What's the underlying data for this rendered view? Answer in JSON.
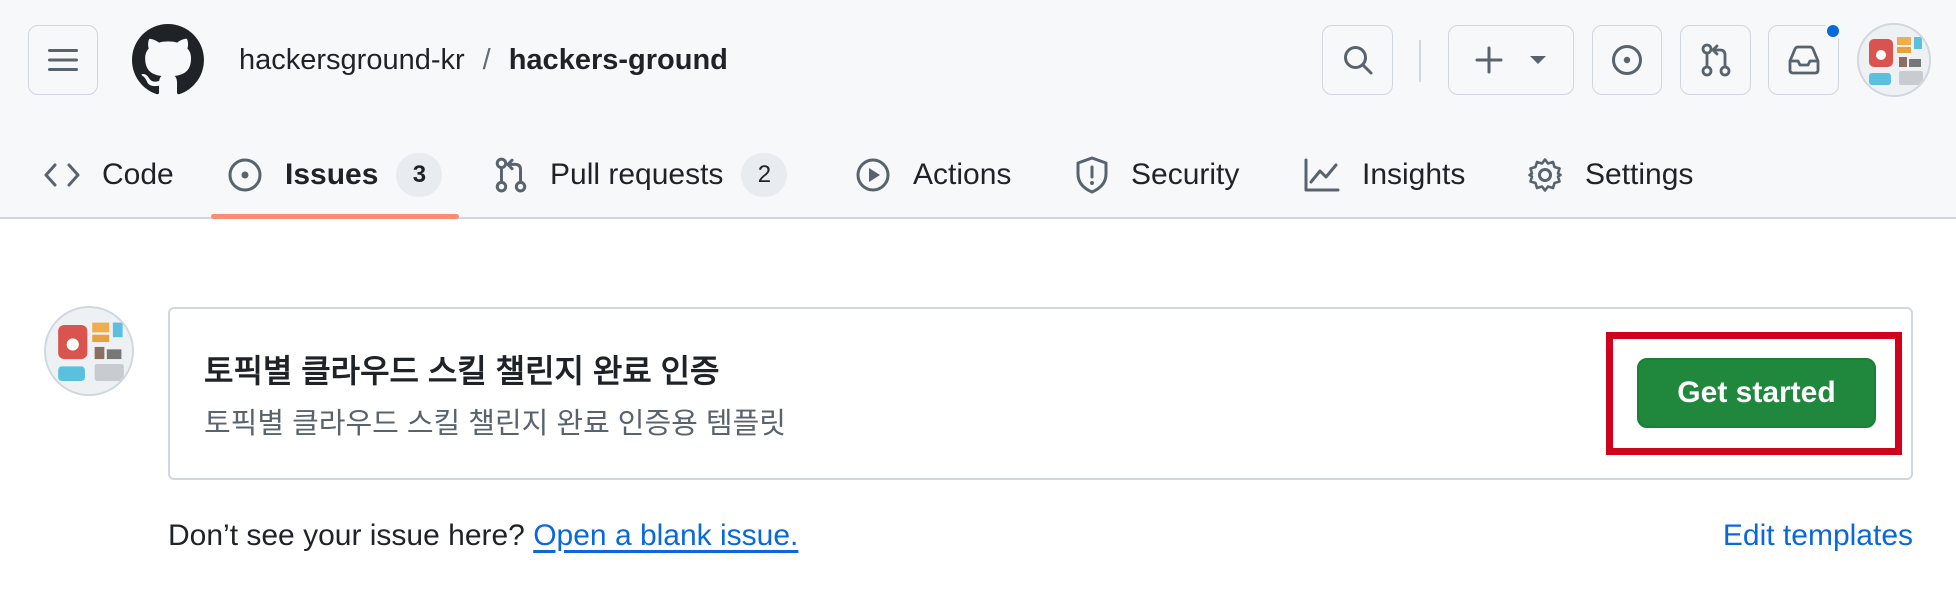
{
  "header": {
    "repo_owner": "hackersground-kr",
    "separator": "/",
    "repo_name": "hackers-ground",
    "icons": {
      "menu": "hamburger-menu-icon",
      "logo": "github-logo-icon",
      "search": "search-icon",
      "create": "plus-icon",
      "create_dropdown": "triangle-down-icon",
      "issues": "issue-opened-icon",
      "pull_requests": "git-pull-request-icon",
      "inbox": "inbox-icon"
    },
    "notification_color": "#0969da"
  },
  "tabs": [
    {
      "label": "Code",
      "icon": "code-icon"
    },
    {
      "label": "Issues",
      "icon": "issue-opened-icon",
      "count": "3",
      "selected": true
    },
    {
      "label": "Pull requests",
      "icon": "git-pull-request-icon",
      "count": "2"
    },
    {
      "label": "Actions",
      "icon": "play-icon"
    },
    {
      "label": "Security",
      "icon": "shield-icon"
    },
    {
      "label": "Insights",
      "icon": "graph-icon"
    },
    {
      "label": "Settings",
      "icon": "gear-icon"
    }
  ],
  "template": {
    "title": "토픽별 클라우드 스킬 챌린지 완료 인증",
    "description": "토픽별 클라우드 스킬 챌린지 완료 인증용 템플릿",
    "button_label": "Get started"
  },
  "footer": {
    "prompt": "Don’t see your issue here?",
    "blank_issue_link": "Open a blank issue.",
    "edit_templates": "Edit templates"
  },
  "colors": {
    "accent_green": "#1f883d",
    "selected_tab_underline": "#fd8c73",
    "link_blue": "#0969da",
    "highlight_red": "#d0021b"
  }
}
